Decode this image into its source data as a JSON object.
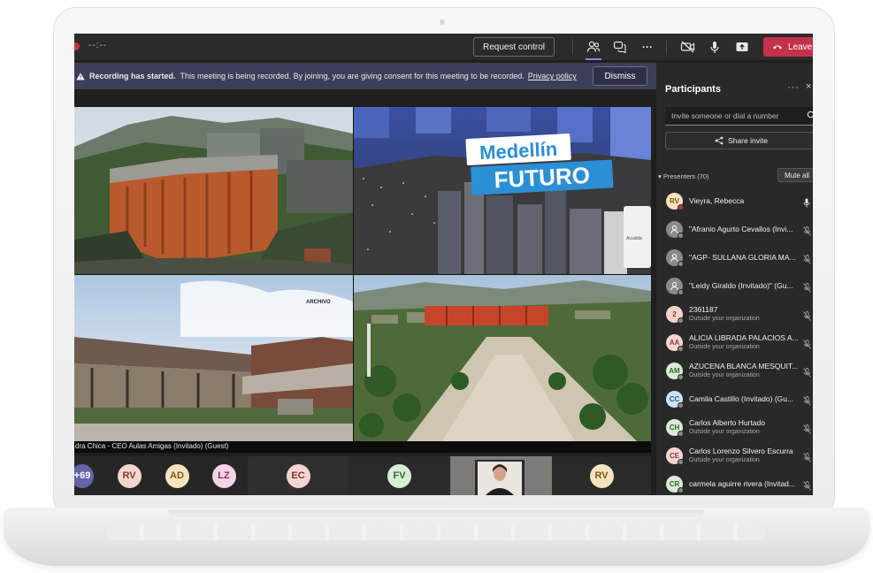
{
  "toolbar": {
    "timer": "--:--",
    "request_control": "Request control",
    "more": "···",
    "leave": "Leave"
  },
  "banner": {
    "title": "Recording has started.",
    "message": "This meeting is being recorded. By joining, you are giving consent for this meeting to be recorded.",
    "privacy_link": "Privacy policy",
    "dismiss": "Dismiss"
  },
  "video": {
    "tiles": [
      {
        "overlay_text": ""
      },
      {
        "overlay_line1": "Medellín",
        "overlay_line2": "FUTURO",
        "side_text": "Alcaldía"
      },
      {
        "overlay_text": "ARCHIVO"
      },
      {
        "overlay_text": ""
      }
    ],
    "caption": "dra Chica - CEO Aulas Amigas (Invitado) (Guest)"
  },
  "strip": [
    {
      "initials": "+69",
      "bg": "#6264a7",
      "fg": "#ffffff"
    },
    {
      "initials": "RV",
      "bg": "#f3d6d2",
      "fg": "#8a3a2f"
    },
    {
      "initials": "AD",
      "bg": "#f5e4bd",
      "fg": "#7a5a14"
    },
    {
      "initials": "LZ",
      "bg": "#f6d4e4",
      "fg": "#8a2d5a"
    },
    {
      "initials": "EC",
      "bg": "#f2d5d3",
      "fg": "#7d3333"
    },
    {
      "initials": "FV",
      "bg": "#d9ecd7",
      "fg": "#2f6b2f"
    },
    {
      "initials": "RV",
      "bg": "#f5e4bd",
      "fg": "#7a5a14"
    }
  ],
  "panel": {
    "title": "Participants",
    "more": "···",
    "close": "×",
    "invite_placeholder": "Invite someone or dial a number",
    "share_invite": "Share invite",
    "presenters_label": "Presenters (70)",
    "mute_all": "Mute all",
    "participants": [
      {
        "initials": "RV",
        "name": "Vieyra, Rebecca",
        "sub": "",
        "bg": "#f5e4bd",
        "fg": "#7a5a14",
        "mic": "on"
      },
      {
        "initials": "",
        "name": "\"Afranio Agurto Cevallos (Invi...",
        "sub": "",
        "bg": "#8a8a8a",
        "fg": "#ffffff",
        "mic": "off"
      },
      {
        "initials": "",
        "name": "\"AGP- SULLANA GLORIA MA...",
        "sub": "",
        "bg": "#8a8a8a",
        "fg": "#ffffff",
        "mic": "off"
      },
      {
        "initials": "",
        "name": "\"Leidy Giraldo (Invitado)\" (Gu...",
        "sub": "",
        "bg": "#8a8a8a",
        "fg": "#ffffff",
        "mic": "off"
      },
      {
        "initials": "2",
        "name": "2361187",
        "sub": "Outside your organization",
        "bg": "#f6d3cb",
        "fg": "#8a3a2f",
        "mic": "off"
      },
      {
        "initials": "AA",
        "name": "ALICIA LIBRADA PALACIOS A...",
        "sub": "Outside your organization",
        "bg": "#f3d6d2",
        "fg": "#8a3a2f",
        "mic": "off"
      },
      {
        "initials": "AM",
        "name": "AZUCENA BLANCA MESQUIT...",
        "sub": "Outside your organization",
        "bg": "#d9ecd7",
        "fg": "#2f6b2f",
        "mic": "off"
      },
      {
        "initials": "CC",
        "name": "Camila Castillo (Invitado) (Gu...",
        "sub": "",
        "bg": "#cfe3f2",
        "fg": "#2a5d87",
        "mic": "off"
      },
      {
        "initials": "CH",
        "name": "Carlos Alberto Hurtado",
        "sub": "Outside your organization",
        "bg": "#d9ecd7",
        "fg": "#2f6b2f",
        "mic": "off"
      },
      {
        "initials": "CE",
        "name": "Carlos Lorenzo Silvero Escurra",
        "sub": "Outside your organization",
        "bg": "#f3d6d2",
        "fg": "#8a3a2f",
        "mic": "off"
      },
      {
        "initials": "CR",
        "name": "carmela aguirre rivera (Invitad...",
        "sub": "",
        "bg": "#d9ecd7",
        "fg": "#2f6b2f",
        "mic": "off"
      }
    ]
  }
}
